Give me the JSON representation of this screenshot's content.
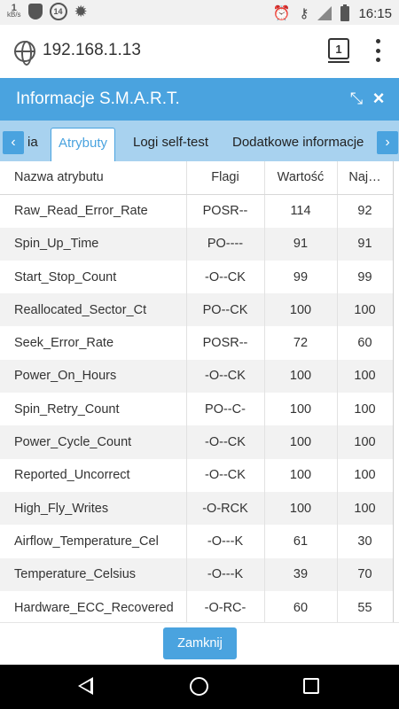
{
  "status_bar": {
    "speed_value": "1",
    "speed_unit": "kB/s",
    "notification_count": "14",
    "time": "16:15",
    "icons": [
      "shield-icon",
      "notification-count-icon",
      "settings-gear-icon",
      "alarm-icon",
      "vpn-key-icon",
      "signal-icon",
      "battery-icon"
    ]
  },
  "browser": {
    "url": "192.168.1.13",
    "tab_count": "1"
  },
  "dialog": {
    "title": "Informacje S.M.A.R.T.",
    "tabs": {
      "partial_left": "ia",
      "active": "Atrybuty",
      "logs": "Logi self-test",
      "extra": "Dodatkowe informacje"
    },
    "table": {
      "headers": [
        "Nazwa atrybutu",
        "Flagi",
        "Wartość",
        "Naj…"
      ],
      "rows": [
        [
          "Raw_Read_Error_Rate",
          "POSR--",
          "114",
          "92"
        ],
        [
          "Spin_Up_Time",
          "PO----",
          "91",
          "91"
        ],
        [
          "Start_Stop_Count",
          "-O--CK",
          "99",
          "99"
        ],
        [
          "Reallocated_Sector_Ct",
          "PO--CK",
          "100",
          "100"
        ],
        [
          "Seek_Error_Rate",
          "POSR--",
          "72",
          "60"
        ],
        [
          "Power_On_Hours",
          "-O--CK",
          "100",
          "100"
        ],
        [
          "Spin_Retry_Count",
          "PO--C-",
          "100",
          "100"
        ],
        [
          "Power_Cycle_Count",
          "-O--CK",
          "100",
          "100"
        ],
        [
          "Reported_Uncorrect",
          "-O--CK",
          "100",
          "100"
        ],
        [
          "High_Fly_Writes",
          "-O-RCK",
          "100",
          "100"
        ],
        [
          "Airflow_Temperature_Cel",
          "-O---K",
          "61",
          "30"
        ],
        [
          "Temperature_Celsius",
          "-O---K",
          "39",
          "70"
        ],
        [
          "Hardware_ECC_Recovered",
          "-O-RC-",
          "60",
          "55"
        ]
      ]
    },
    "close_label": "Zamknij"
  },
  "colors": {
    "accent": "#4aa3df",
    "tabbar": "#a8d2ef",
    "row_alt": "#f2f2f2"
  }
}
